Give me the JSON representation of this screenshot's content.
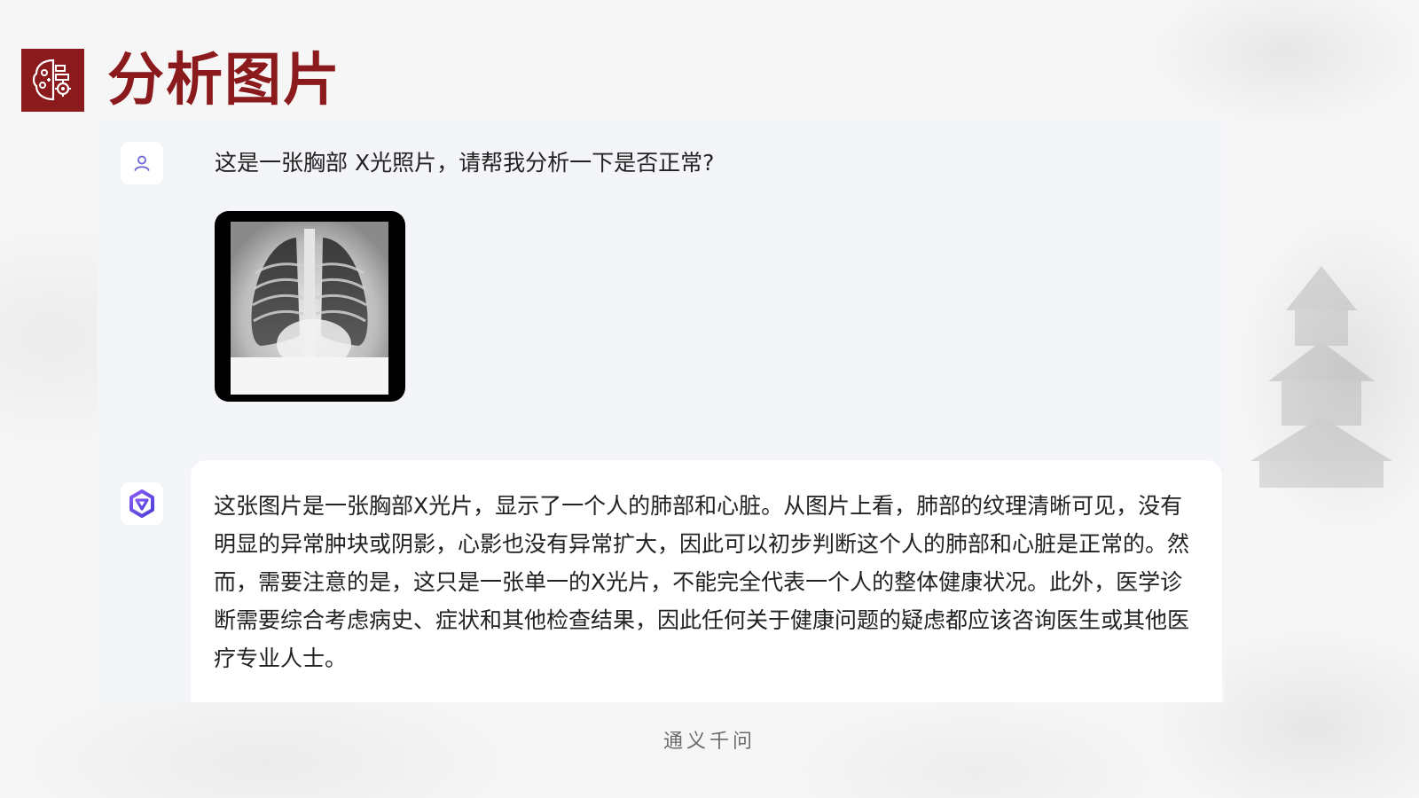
{
  "header": {
    "title": "分析图片",
    "logo_icon": "brain-gear-icon",
    "accent_color": "#8b1a1d"
  },
  "chat": {
    "user_avatar_icon": "user-icon",
    "bot_avatar_icon": "tongyi-logo-icon",
    "user_message": "这是一张胸部 X光照片，请帮我分析一下是否正常?",
    "user_image": "chest-xray-image",
    "bot_message": "这张图片是一张胸部X光片，显示了一个人的肺部和心脏。从图片上看，肺部的纹理清晰可见，没有明显的异常肿块或阴影，心影也没有异常扩大，因此可以初步判断这个人的肺部和心脏是正常的。然而，需要注意的是，这只是一张单一的X光片，不能完全代表一个人的整体健康状况。此外，医学诊断需要综合考虑病史、症状和其他检查结果，因此任何关于健康问题的疑虑都应该咨询医生或其他医疗专业人士。"
  },
  "footer": {
    "caption": "通义千问"
  }
}
